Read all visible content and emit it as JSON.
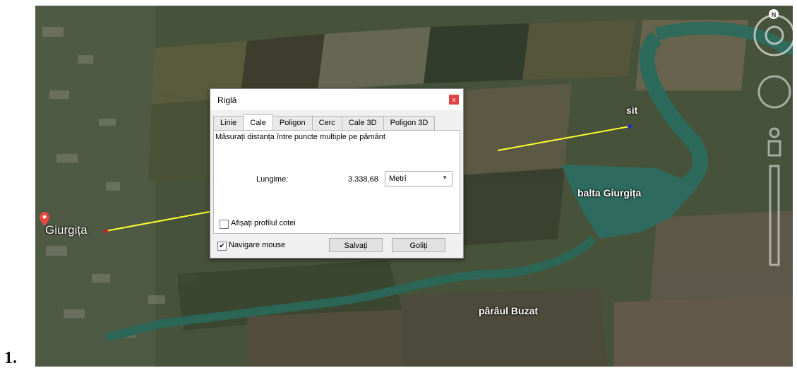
{
  "figure_number": "1.",
  "map": {
    "place_label": "Giurgița",
    "labels": {
      "sit": "sit",
      "balta": "balta Giurgița",
      "paraul": "pârâul Buzat"
    },
    "compass": "N",
    "measure_line_color": "#ffff33"
  },
  "dialog": {
    "title": "Riglă",
    "close": "x",
    "tabs": [
      {
        "label": "Linie",
        "active": false
      },
      {
        "label": "Cale",
        "active": true
      },
      {
        "label": "Poligon",
        "active": false
      },
      {
        "label": "Cerc",
        "active": false
      },
      {
        "label": "Cale 3D",
        "active": false
      },
      {
        "label": "Poligon 3D",
        "active": false
      }
    ],
    "description": "Măsurați distanța între puncte multiple pe pământ",
    "length_label": "Lungime:",
    "length_value": "3.338,68",
    "unit": "Metri",
    "profile_label": "Afișați profilul cotei",
    "profile_checked": false,
    "mouse_nav_label": "Navigare mouse",
    "mouse_nav_checked": "✔",
    "save_button": "Salvați",
    "clear_button": "Goliți"
  }
}
